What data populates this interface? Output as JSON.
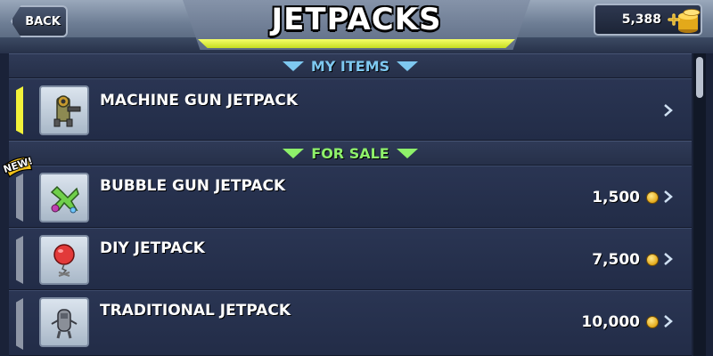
{
  "header": {
    "title": "JETPACKS",
    "back_label": "BACK",
    "coins": "5,388"
  },
  "sections": {
    "my_items": "MY ITEMS",
    "for_sale": "FOR SALE"
  },
  "my_items": [
    {
      "name": "MACHINE GUN JETPACK",
      "icon": "machine-gun-jetpack-icon"
    }
  ],
  "for_sale": [
    {
      "name": "BUBBLE GUN JETPACK",
      "price": "1,500",
      "badge": "NEW!",
      "icon": "bubble-gun-jetpack-icon"
    },
    {
      "name": "DIY JETPACK",
      "price": "7,500",
      "icon": "diy-jetpack-icon"
    },
    {
      "name": "TRADITIONAL JETPACK",
      "price": "10,000",
      "icon": "traditional-jetpack-icon"
    }
  ],
  "colors": {
    "my_items_accent": "#7ec8f0",
    "for_sale_accent": "#8ef06a",
    "selected_marker": "#f2f23a",
    "title_glow": "#e8ff40"
  }
}
